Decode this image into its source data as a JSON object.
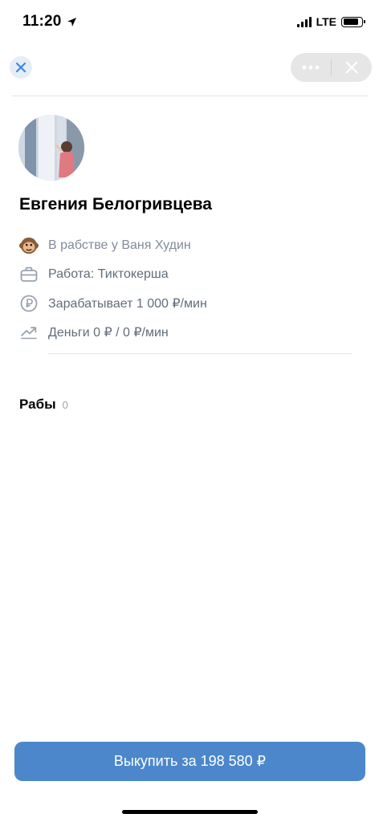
{
  "status_bar": {
    "time": "11:20",
    "network": "LTE",
    "battery_level": 0.85
  },
  "header": {
    "close_icon": "close-icon",
    "more_icon": "more-horizontal-icon",
    "dismiss_icon": "close-icon",
    "accent": "#3f8ae0"
  },
  "profile": {
    "name": "Евгения Белогривцева"
  },
  "info": [
    {
      "icon": "monkey-emoji-icon",
      "text": "В рабстве у Ваня Худин"
    },
    {
      "icon": "briefcase-icon",
      "text": "Работа: Тиктокерша"
    },
    {
      "icon": "ruble-circle-icon",
      "text": "Зарабатывает 1 000 ₽/мин"
    },
    {
      "icon": "trending-up-icon",
      "text": "Деньги 0 ₽ / 0 ₽/мин"
    }
  ],
  "slaves": {
    "title": "Рабы",
    "count": "0"
  },
  "buy_button": {
    "label": "Выкупить за 198 580 ₽",
    "color": "#4c87cb"
  }
}
